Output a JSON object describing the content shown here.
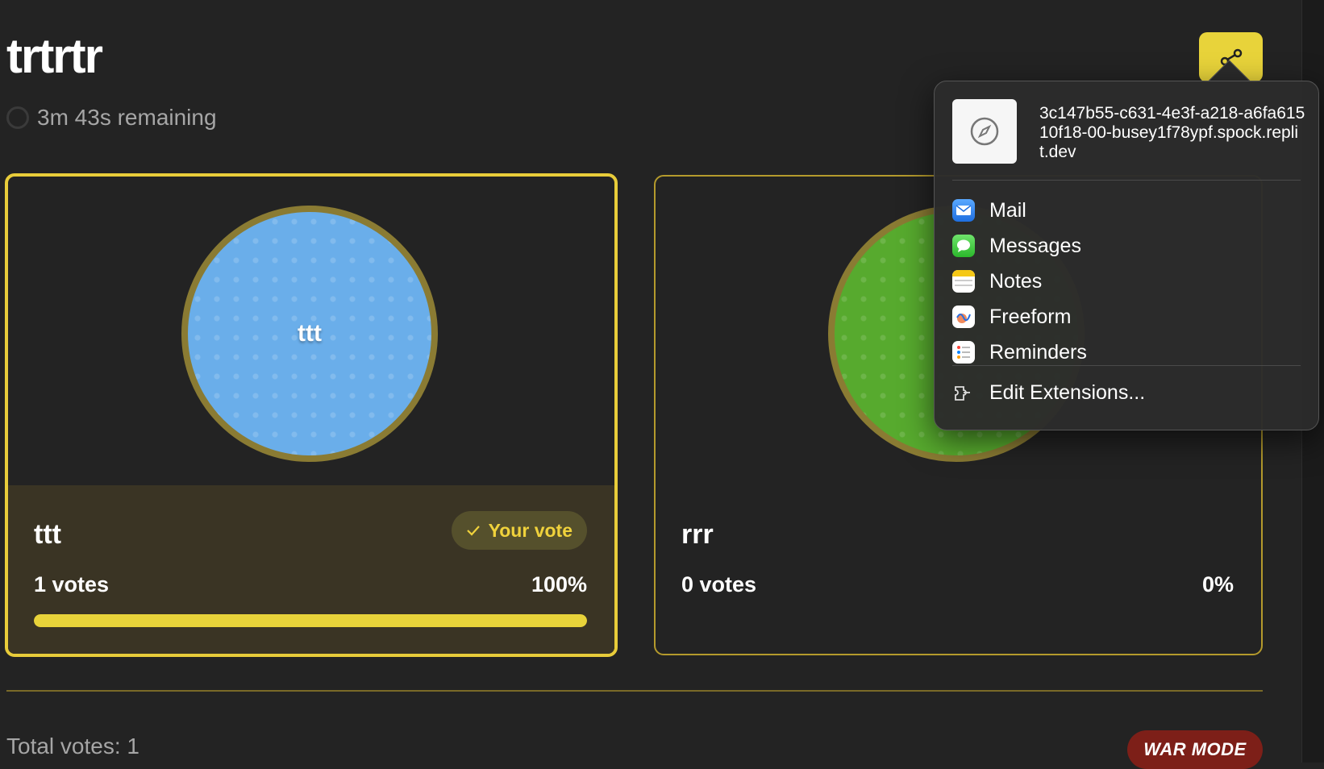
{
  "poll": {
    "title": "trtrtr",
    "timer_text": "3m 43s remaining"
  },
  "options": [
    {
      "name": "ttt",
      "circle_label": "ttt",
      "votes_text": "1 votes",
      "percent_text": "100%",
      "progress": 1.0,
      "badge": "Your vote",
      "color": "#6aaeea"
    },
    {
      "name": "rrr",
      "votes_text": "0 votes",
      "percent_text": "0%",
      "progress": 0.0,
      "color": "#57aa2e"
    }
  ],
  "footer": {
    "total_text": "Total votes: 1",
    "mode_badge": "WAR MODE"
  },
  "share_menu": {
    "url": "3c147b55-c631-4e3f-a218-a6fa61510f18-00-busey1f78ypf.spock.replit.dev",
    "items": [
      {
        "label": "Mail",
        "icon": "mail-icon"
      },
      {
        "label": "Messages",
        "icon": "messages-icon"
      },
      {
        "label": "Notes",
        "icon": "notes-icon"
      },
      {
        "label": "Freeform",
        "icon": "freeform-icon"
      },
      {
        "label": "Reminders",
        "icon": "reminders-icon"
      }
    ],
    "edit_extensions": "Edit Extensions..."
  },
  "colors": {
    "accent": "#e8d33a",
    "background": "#232323",
    "war_badge": "#7d1f18"
  }
}
